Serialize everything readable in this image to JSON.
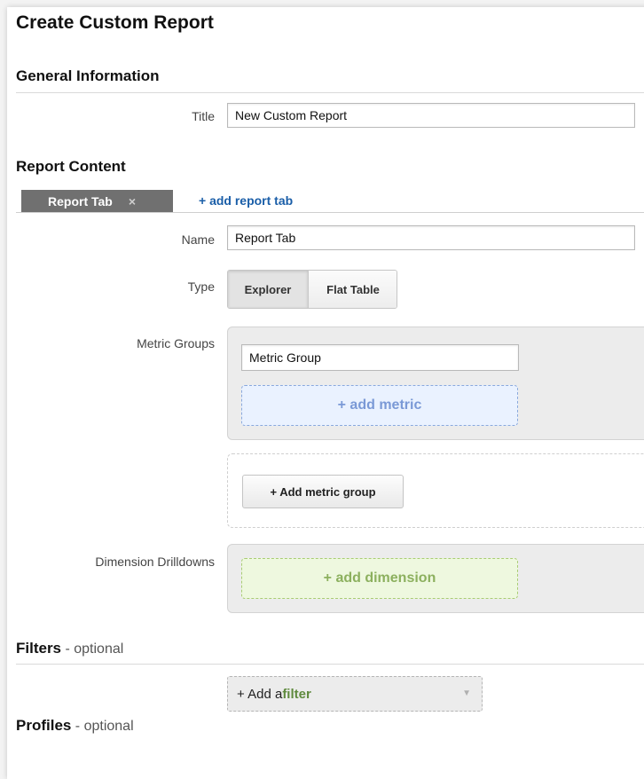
{
  "page_title": "Create Custom Report",
  "general": {
    "heading": "General Information",
    "title_label": "Title",
    "title_value": "New Custom Report"
  },
  "content": {
    "heading": "Report Content",
    "active_tab": "Report Tab",
    "tab_close": "×",
    "add_tab_link": "+ add report tab",
    "name_label": "Name",
    "name_value": "Report Tab",
    "type_label": "Type",
    "type_options": [
      "Explorer",
      "Flat Table"
    ],
    "type_selected": "Explorer",
    "metric_groups_label": "Metric Groups",
    "metric_group_value": "Metric Group",
    "add_metric": "+ add metric",
    "add_metric_group": "+ Add metric group",
    "dimension_label": "Dimension Drilldowns",
    "add_dimension": "+ add dimension"
  },
  "filters": {
    "heading": "Filters",
    "optional": " - optional",
    "add_prefix": "+ Add a ",
    "add_keyword": "filter",
    "chevron_icon": "chevron-down-icon"
  },
  "profiles": {
    "heading": "Profiles",
    "optional": " - optional"
  },
  "colors": {
    "link": "#1a5ea8",
    "tab_bg": "#707070",
    "metric_accent": "#7a99d6",
    "dimension_accent": "#8cb05e"
  }
}
